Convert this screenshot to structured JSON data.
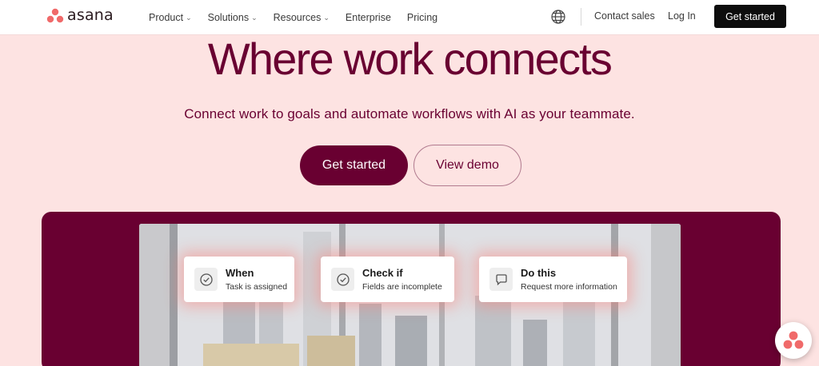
{
  "header": {
    "logo_text": "asana",
    "nav": [
      {
        "label": "Product",
        "has_dropdown": true
      },
      {
        "label": "Solutions",
        "has_dropdown": true
      },
      {
        "label": "Resources",
        "has_dropdown": true
      },
      {
        "label": "Enterprise",
        "has_dropdown": false
      },
      {
        "label": "Pricing",
        "has_dropdown": false
      }
    ],
    "globe_icon": "globe-icon",
    "contact_sales": "Contact sales",
    "log_in": "Log In",
    "get_started": "Get started"
  },
  "hero": {
    "title": "Where work connects",
    "subtitle": "Connect work to goals and automate workflows with AI as your teammate.",
    "primary_cta": "Get started",
    "secondary_cta": "View demo"
  },
  "workflow_cards": [
    {
      "icon": "check-circle-icon",
      "title": "When",
      "description": "Task is assigned"
    },
    {
      "icon": "check-circle-icon",
      "title": "Check if",
      "description": "Fields are incomplete"
    },
    {
      "icon": "speech-bubble-icon",
      "title": "Do this",
      "description": "Request more information"
    }
  ],
  "colors": {
    "brand_plum": "#690031",
    "hero_background": "#fde3e2",
    "logo_coral": "#f06a6a",
    "header_cta": "#0d0d0d"
  }
}
